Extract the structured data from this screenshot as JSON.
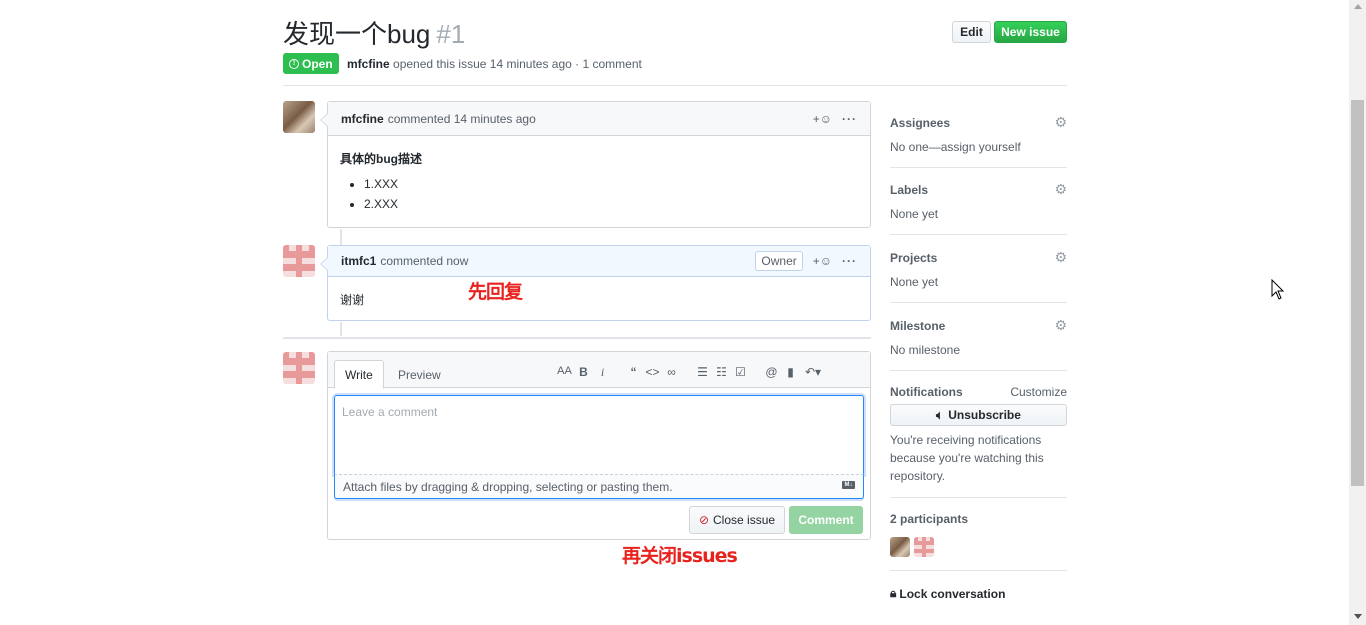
{
  "issue": {
    "title": "发现一个bug",
    "number": "#1",
    "state": "Open",
    "author": "mfcfine",
    "meta_text": "opened this issue 14 minutes ago · 1 comment",
    "edit_label": "Edit",
    "new_issue_label": "New issue"
  },
  "comments": [
    {
      "author": "mfcfine",
      "action": "commented 14 minutes ago",
      "body_title": "具体的bug描述",
      "items": [
        "1.XXX",
        "2.XXX"
      ]
    },
    {
      "author": "itmfc1",
      "action": "commented now",
      "badge": "Owner",
      "body": "谢谢"
    }
  ],
  "editor": {
    "tab_write": "Write",
    "tab_preview": "Preview",
    "placeholder": "Leave a comment",
    "attach_text": "Attach files by dragging & dropping, selecting or pasting them.",
    "close_label": "Close issue",
    "comment_label": "Comment"
  },
  "annotations": {
    "reply_first": "先回复",
    "then_close": "再关闭issues"
  },
  "sidebar": {
    "assignees": {
      "label": "Assignees",
      "value": "No one—assign yourself"
    },
    "labels": {
      "label": "Labels",
      "value": "None yet"
    },
    "projects": {
      "label": "Projects",
      "value": "None yet"
    },
    "milestone": {
      "label": "Milestone",
      "value": "No milestone"
    },
    "notifications": {
      "label": "Notifications",
      "customize": "Customize",
      "unsubscribe": "Unsubscribe",
      "reason": "You're receiving notifications because you're watching this repository."
    },
    "participants": "2 participants",
    "lock": "Lock conversation"
  },
  "colors": {
    "open_green": "#2cbe4e",
    "new_issue_green": "#28a745",
    "annotation_red": "#e8231d"
  }
}
